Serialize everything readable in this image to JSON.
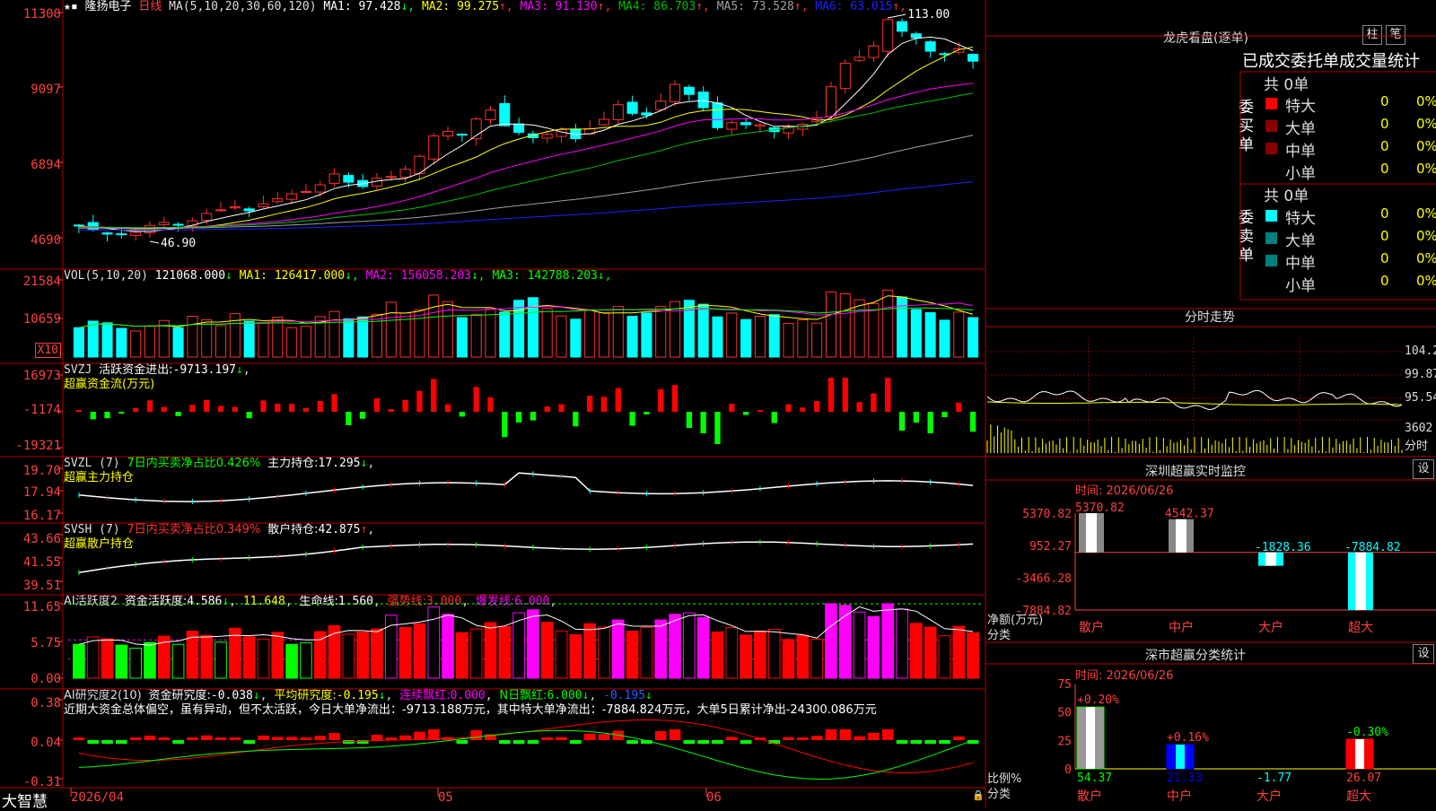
{
  "colors": {
    "up": "#ff3030",
    "down": "#00ffff",
    "ma1": "#ffffff",
    "ma2": "#ffff00",
    "ma3": "#ff00ff",
    "ma4": "#00c000",
    "ma5": "#a0a0a0",
    "ma6": "#2020ff",
    "green": "#00ff00",
    "red": "#ff0000"
  },
  "main": {
    "stock_name": "隆扬电子",
    "period": "日线",
    "ma_params": "MA(5,10,20,30,60,120)",
    "ma": [
      {
        "label": "MA1:",
        "value": "97.428",
        "arrow": "↓"
      },
      {
        "label": "MA2:",
        "value": "99.275",
        "arrow": "↑"
      },
      {
        "label": "MA3:",
        "value": "91.130",
        "arrow": "↑"
      },
      {
        "label": "MA4:",
        "value": "86.703",
        "arrow": "↑"
      },
      {
        "label": "MA5:",
        "value": "73.528",
        "arrow": "↑"
      },
      {
        "label": "MA6:",
        "value": "63.015",
        "arrow": "↑"
      }
    ],
    "yticks": [
      "11300",
      "9097",
      "6894",
      "4690"
    ],
    "high_label": "113.00",
    "low_label": "46.90"
  },
  "vol": {
    "params": "VOL(5,10,20)",
    "value": "121068.000",
    "arrow": "↓",
    "ma": [
      {
        "label": "MA1:",
        "value": "126417.000",
        "arrow": "↓"
      },
      {
        "label": "MA2:",
        "value": "156058.203",
        "arrow": "↓"
      },
      {
        "label": "MA3:",
        "value": "142788.203",
        "arrow": "↓"
      }
    ],
    "yticks": [
      "21584",
      "10659"
    ],
    "unit": "X10"
  },
  "svzj": {
    "name": "SVZJ",
    "label": "活跃资金进出:",
    "value": "-9713.197",
    "arrow": "↓",
    "sub": "超赢资金流(万元)",
    "yticks": [
      "16973",
      "-1174",
      "-19321"
    ]
  },
  "svzl": {
    "name": "SVZL (7)",
    "label7": "7日内买卖净占比0.426%",
    "label": "主力持仓:",
    "value": "17.295",
    "arrow": "↓",
    "sub": "超赢主力持仓",
    "yticks": [
      "19.70",
      "17.94",
      "16.17"
    ]
  },
  "svsh": {
    "name": "SVSH (7)",
    "label7": "7日内买卖净占比0.349%",
    "label": "散户持仓:",
    "value": "42.875",
    "arrow": "↑",
    "sub": "超赢散户持仓",
    "yticks": [
      "43.66",
      "41.55",
      "39.51"
    ]
  },
  "ai1": {
    "name": "AI活跃度2",
    "l1": "资金活跃度:",
    "v1": "4.586",
    "a1": "↓",
    "v2": "11.648",
    "l3": "生命线:",
    "v3": "1.560",
    "l4": "强势线:",
    "v4": "3.000",
    "l5": "爆发线:",
    "v5": "6.000",
    "yticks": [
      "11.65",
      "5.75",
      "0.00"
    ]
  },
  "ai2": {
    "name": "AI研究度2(10)",
    "l1": "资金研究度:",
    "v1": "-0.038",
    "a1": "↓",
    "l2": "平均研究度:",
    "v2": "-0.195",
    "a2": "↓",
    "l3": "连续飘红:",
    "v3": "0.000",
    "l4": "N日飘红:",
    "v4": "6.000",
    "v5": "-0.195",
    "a5": "↓",
    "text": "近期大资金总体偏空，虽有异动，但不太活跃，今日大单净流出：-9713.188万元，其中特大单净流出：-7884.824万元，大单5日累计净出-24300.086万元",
    "yticks": [
      "0.38",
      "0.04",
      "-0.31"
    ]
  },
  "xaxis": {
    "brand": "大智慧",
    "labels": [
      "2026/04",
      "05",
      "06"
    ]
  },
  "right": {
    "lhkp_title": "龙虎看盘(逐单)",
    "btn_zhu": "柱",
    "btn_bi": "笔",
    "tabs": [
      "已成交",
      "委托单",
      "成交量统计"
    ],
    "buy": {
      "side": "委买单",
      "total": "共 0单",
      "rows": [
        {
          "name": "特大",
          "count": "0",
          "pct": "0%"
        },
        {
          "name": "大单",
          "count": "0",
          "pct": "0%"
        },
        {
          "name": "中单",
          "count": "0",
          "pct": "0%"
        },
        {
          "name": "小单",
          "count": "0",
          "pct": "0%"
        }
      ]
    },
    "sell": {
      "side": "委卖单",
      "total": "共 0单",
      "rows": [
        {
          "name": "特大",
          "count": "0",
          "pct": "0%"
        },
        {
          "name": "大单",
          "count": "0",
          "pct": "0%"
        },
        {
          "name": "中单",
          "count": "0",
          "pct": "0%"
        },
        {
          "name": "小单",
          "count": "0",
          "pct": "0%"
        }
      ]
    },
    "fenshi": {
      "title": "分时走势",
      "yticks": [
        "104.2",
        "99.87",
        "95.54"
      ],
      "vol_label": "3602",
      "unit": "分时"
    },
    "monitor": {
      "title": "深圳超赢实时监控",
      "btn": "设",
      "time": "时间: 2026/06/26",
      "ylabel1": "净额(万元)",
      "ylabel2": "分类",
      "yticks": [
        "5370.82",
        "952.27",
        "-3466.28",
        "-7884.82"
      ],
      "cats": [
        "散户",
        "中户",
        "大户",
        "超大"
      ],
      "values": [
        5370.82,
        4542.37,
        -1828.36,
        -7884.82
      ],
      "labels": [
        "5370.82",
        "4542.37",
        "-1828.36",
        "-7884.82"
      ]
    },
    "classify": {
      "title": "深市超赢分类统计",
      "btn": "设",
      "time": "时间: 2026/06/26",
      "ylabel1": "比例%",
      "ylabel2": "分类",
      "yticks": [
        "75",
        "50",
        "25",
        "0"
      ],
      "cats": [
        "散户",
        "中户",
        "大户",
        "超大"
      ],
      "values": [
        54.37,
        21.33,
        -1.77,
        26.07
      ],
      "changes": [
        "+0.20%",
        "+0.16%",
        "",
        "-0.30%"
      ]
    }
  },
  "chart_data": {
    "type": "candlestick",
    "title": "隆扬电子 日线",
    "close": [
      50.6,
      49.2,
      48.0,
      47.8,
      48.5,
      50.6,
      51.5,
      50.7,
      52.0,
      54.2,
      55.3,
      56.2,
      55.0,
      57.1,
      58.6,
      60.1,
      60.8,
      62.8,
      66.1,
      63.6,
      62.3,
      64.8,
      65.3,
      67.5,
      71.4,
      77.5,
      78.9,
      78.0,
      82.6,
      85.3,
      80.6,
      78.6,
      77.0,
      78.0,
      79.4,
      76.7,
      79.7,
      82.5,
      86.9,
      84.3,
      83.8,
      88.0,
      93.0,
      90.0,
      86.0,
      80.0,
      81.5,
      80.9,
      80.9,
      78.8,
      80.2,
      81.0,
      83.0,
      92.3,
      99.4,
      101.2,
      104.6,
      112.5,
      109.0,
      107.0,
      103.0,
      102.0,
      103.7,
      100.0
    ],
    "volume": [
      9000,
      11000,
      10500,
      8800,
      8000,
      9500,
      11200,
      9000,
      12500,
      11400,
      9600,
      13300,
      11000,
      10400,
      12200,
      9000,
      9400,
      12400,
      14000,
      11700,
      12300,
      13100,
      16800,
      13500,
      14500,
      19000,
      17000,
      12100,
      13100,
      14800,
      13800,
      17400,
      18200,
      14900,
      12600,
      11600,
      14500,
      13600,
      15500,
      12500,
      13500,
      15500,
      17000,
      17400,
      16200,
      12300,
      13500,
      11500,
      12500,
      13000,
      10300,
      11400,
      10400,
      20000,
      19400,
      17600,
      16400,
      20500,
      18400,
      14600,
      13600,
      11300,
      13800,
      12100
    ],
    "ma5": [],
    "ylim": [
      4690,
      11300
    ]
  }
}
